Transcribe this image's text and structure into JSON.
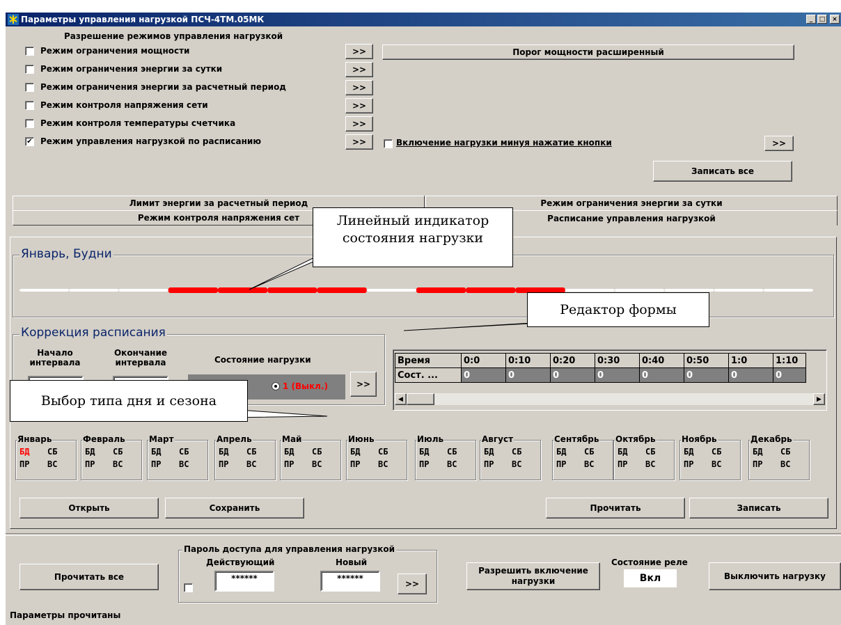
{
  "window": {
    "title": "Параметры управления нагрузкой ПСЧ-4ТМ.05МК"
  },
  "modes": {
    "group_title": "Разрешение режимов управления нагрузкой",
    "items": [
      {
        "label": "Режим ограничения мощности",
        "checked": false
      },
      {
        "label": "Режим ограничения энергии за сутки",
        "checked": false
      },
      {
        "label": "Режим ограничения энергии за расчетный период",
        "checked": false
      },
      {
        "label": "Режим контроля напряжения сети",
        "checked": false
      },
      {
        "label": "Режим контроля температуры счетчика",
        "checked": false
      },
      {
        "label": "Режим управления нагрузкой по расписанию",
        "checked": true
      }
    ],
    "arrow_label": ">>",
    "power_threshold_button": "Порог мощности расширенный",
    "bypass_label": "Включение нагрузки минуя нажатие кнопки",
    "write_all_button": "Записать все"
  },
  "tabs": {
    "row1": [
      "Лимит энергии за расчетный период",
      "Режим ограничения энергии за сутки"
    ],
    "row2": [
      "Режим контроля напряжения сет",
      "Расписание управления нагрузкой"
    ]
  },
  "schedule": {
    "group_title": "Январь, Будни",
    "load_state_fill": [
      0,
      0,
      0,
      1,
      1,
      1,
      1,
      0,
      1,
      1,
      1,
      0,
      0,
      0,
      0,
      0
    ]
  },
  "correction": {
    "group_title": "Коррекция расписания",
    "start_label": "Начало интервала",
    "end_label": "Окончание интервала",
    "state_label": "Состояние нагрузки",
    "state_value": "1 (Выкл.)",
    "arrow_label": ">>"
  },
  "grid": {
    "headers": [
      "Время",
      "0:0",
      "0:10",
      "0:20",
      "0:30",
      "0:40",
      "0:50",
      "1:0",
      "1:10"
    ],
    "row_label": "Сост. ...",
    "values": [
      "0",
      "0",
      "0",
      "0",
      "0",
      "0",
      "0",
      "0"
    ]
  },
  "months": [
    {
      "name": "Январь",
      "selected": "БД"
    },
    {
      "name": "Февраль"
    },
    {
      "name": "Март"
    },
    {
      "name": "Апрель"
    },
    {
      "name": "Май"
    },
    {
      "name": "Июнь"
    },
    {
      "name": "Июль"
    },
    {
      "name": "Август"
    },
    {
      "name": "Сентябрь"
    },
    {
      "name": "Октябрь"
    },
    {
      "name": "Ноябрь"
    },
    {
      "name": "Декабрь"
    }
  ],
  "day_types": [
    "БД",
    "СБ",
    "ПР",
    "ВС"
  ],
  "file_buttons": {
    "open": "Открыть",
    "save": "Сохранить",
    "read": "Прочитать",
    "write": "Записать"
  },
  "bottom": {
    "read_all": "Прочитать все",
    "password_group": "Пароль доступа для управления нагрузкой",
    "current_label": "Действующий",
    "new_label": "Новый",
    "current_value": "******",
    "new_value": "******",
    "arrow_label": ">>",
    "allow_button": "Разрешить включение нагрузки",
    "relay_label": "Состояние реле",
    "relay_value": "Вкл",
    "off_button": "Выключить нагрузку",
    "status": "Параметры прочитаны"
  },
  "callouts": {
    "indicator": "Линейный индикатор состояния нагрузки",
    "editor": "Редактор формы",
    "day_select": "Выбор типа дня и сезона"
  },
  "colors": {
    "title_bar": "#0a246a",
    "active_red": "#ff0000",
    "bypass": "#f00000",
    "label_blue": "#0a246a"
  }
}
